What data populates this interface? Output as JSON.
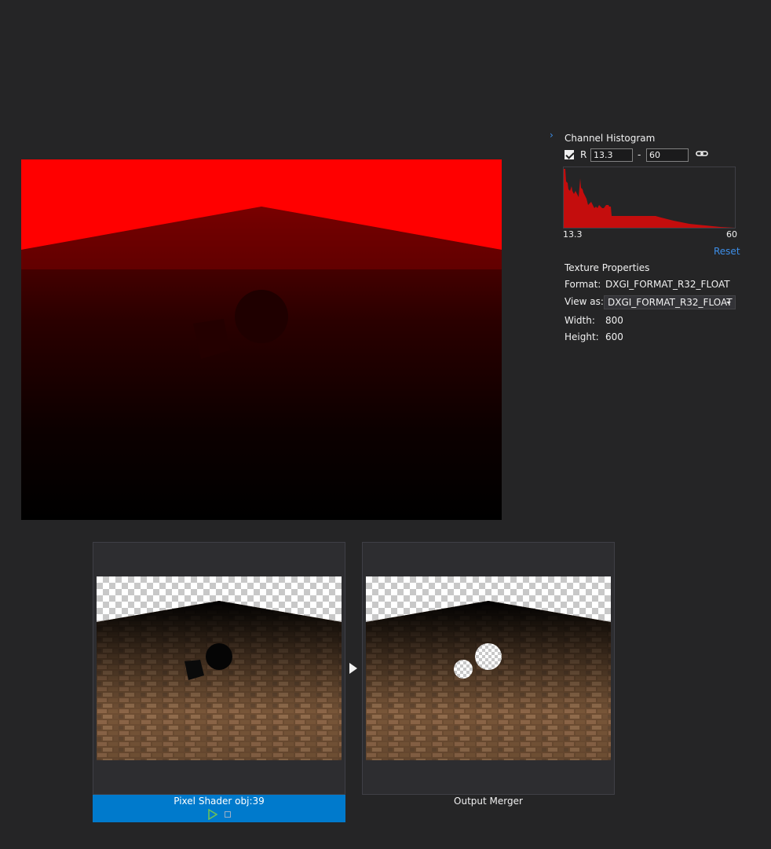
{
  "panel": {
    "title": "Channel Histogram",
    "channel": {
      "label": "R",
      "checked": true,
      "min": "13.3",
      "max": "60"
    },
    "histogram": {
      "min_label": "13.3",
      "max_label": "60",
      "color": "#c40d0d"
    },
    "reset_label": "Reset"
  },
  "texture": {
    "title": "Texture Properties",
    "format_label": "Format:",
    "format_value": "DXGI_FORMAT_R32_FLOAT",
    "view_as_label": "View as:",
    "view_as_value": "DXGI_FORMAT_R32_FLOAT",
    "width_label": "Width:",
    "width_value": "800",
    "height_label": "Height:",
    "height_value": "600"
  },
  "stages": [
    {
      "label": "Pixel Shader obj:39",
      "selected": true
    },
    {
      "label": "Output Merger",
      "selected": false
    }
  ],
  "colors": {
    "accent": "#007acc",
    "link": "#3d8ee8",
    "depth_red": "#ff0000",
    "background": "#252526"
  }
}
